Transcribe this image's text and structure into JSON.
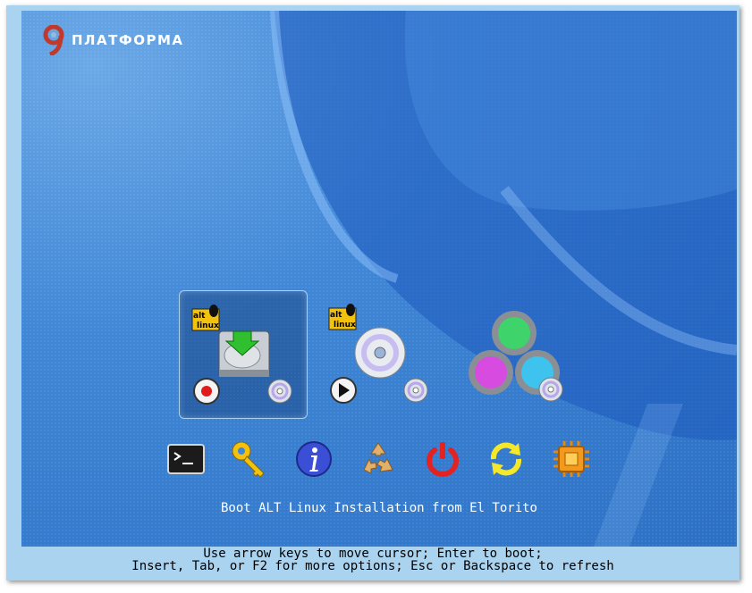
{
  "logo": {
    "text": "ПЛАТФОРМА",
    "glyph": "9"
  },
  "boot_entries": [
    {
      "id": "install-hdd",
      "selected": true,
      "icons": [
        "alt-linux-badge-icon",
        "hard-disk-install-icon",
        "record-icon",
        "cdrom-icon"
      ]
    },
    {
      "id": "live-cd",
      "selected": false,
      "icons": [
        "alt-linux-badge-icon",
        "cd-disc-icon",
        "play-icon",
        "cdrom-icon"
      ]
    },
    {
      "id": "rescue-or-other",
      "selected": false,
      "icons": [
        "colored-circles-icon",
        "cdrom-icon"
      ]
    }
  ],
  "tool_icons": [
    "terminal-icon",
    "key-icon",
    "info-icon",
    "recycle-icon",
    "power-icon",
    "refresh-icon",
    "chip-icon"
  ],
  "selected_caption": "Boot ALT Linux Installation from El Torito",
  "help": {
    "line1": "Use arrow keys to move cursor; Enter to boot;",
    "line2": "Insert, Tab, or F2 for more options; Esc or Backspace to refresh"
  },
  "colors": {
    "frame": "#a9d3ef",
    "background": "#3f86d6",
    "text": "#ffffff"
  }
}
